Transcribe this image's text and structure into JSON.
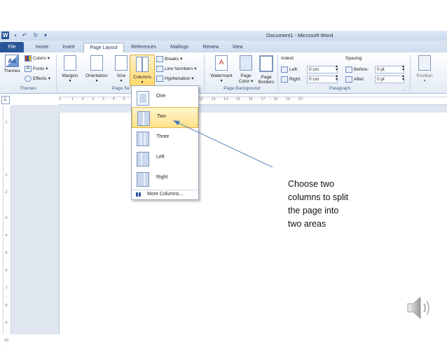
{
  "window": {
    "title": "Document1 - Microsoft Word",
    "word_icon_letter": "W"
  },
  "tabs": [
    "File",
    "Home",
    "Insert",
    "Page Layout",
    "References",
    "Mailings",
    "Review",
    "View"
  ],
  "ribbon": {
    "themes": {
      "big_label": "Themes",
      "colors": "Colors",
      "fonts": "Fonts",
      "effects": "Effects",
      "group": "Themes"
    },
    "page_setup": {
      "margins": "Margins",
      "orientation": "Orientation",
      "size": "Size",
      "columns": "Columns",
      "breaks": "Breaks",
      "line_numbers": "Line Numbers",
      "hyphenation": "Hyphenation",
      "group": "Page Se"
    },
    "page_background": {
      "watermark": "Watermark",
      "page_color_1": "Page",
      "page_color_2": "Color",
      "page_borders_1": "Page",
      "page_borders_2": "Borders",
      "group": "Page Background"
    },
    "paragraph": {
      "indent": "Indent",
      "left_label": "Left:",
      "left_value": "0 cm",
      "right_label": "Right:",
      "right_value": "0 cm",
      "spacing": "Spacing",
      "before_label": "Before:",
      "before_value": "0 pt",
      "after_label": "After:",
      "after_value": "0 pt",
      "group": "Paragraph"
    },
    "position": "Position"
  },
  "ruler": "1 · · · · 1 · · · 2 · · · 1 · · · 3 · · · 4 · · · 5 · · · 6 · · · 7 · · · 8 · · · 9 · · · 10 · · · 11 · · · 12 · · · 13 · · · 14 · · · 15 · · · 16 · · · 17 · · · 18 · · · 19 · · · 20",
  "columns_menu": {
    "items": [
      "One",
      "Two",
      "Three",
      "Left",
      "Right"
    ],
    "more": "More Columns..."
  },
  "annotation": [
    "Choose two",
    "columns to split",
    "the page into",
    "two areas"
  ],
  "icons": {
    "speaker": "speaker-icon",
    "arrow": "annotation-arrow"
  }
}
